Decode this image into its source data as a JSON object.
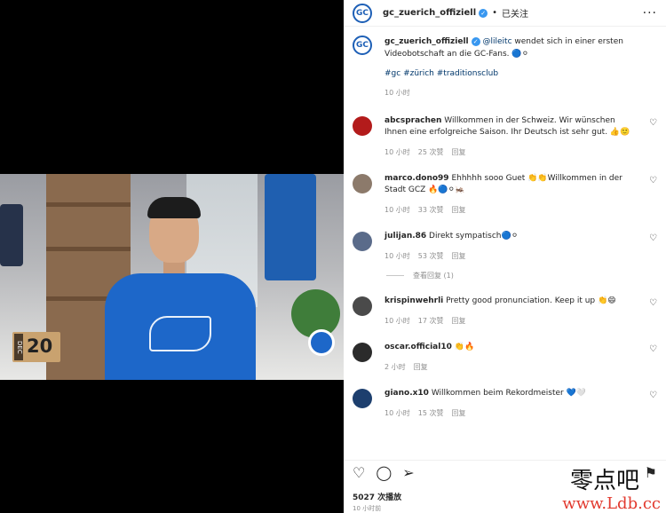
{
  "post": {
    "username": "gc_zuerich_offiziell",
    "follow_label": "已关注",
    "more_label": "···",
    "caption_mention": "@lileitc",
    "caption_text": " wendet sich in einer ersten Videobotschaft an die GC-Fans. 🔵⚪",
    "hashtags": "#gc #zürich #traditionsclub",
    "caption_time": "10 小时",
    "likes": "5027 次播放",
    "posted": "10 小时前"
  },
  "video": {
    "calendar_month": "DEC",
    "calendar_day": "20"
  },
  "comments": [
    {
      "user": "abcsprachen",
      "text": "Willkommen in der Schweiz. Wir wünschen Ihnen eine erfolgreiche Saison. Ihr Deutsch ist sehr gut. 👍🙂",
      "time": "10 小时",
      "likes": "25 次赞",
      "reply": "回复",
      "avatar_color": "#b31b1b"
    },
    {
      "user": "marco.dono99",
      "text": "Ehhhhh sooo Guet 👏👏Willkommen in der Stadt GCZ 🔥🔵⚪🦗",
      "time": "10 小时",
      "likes": "33 次赞",
      "reply": "回复",
      "avatar_color": "#8c7a6b"
    },
    {
      "user": "julijan.86",
      "text": "Direkt sympatisch🔵⚪",
      "time": "10 小时",
      "likes": "53 次赞",
      "reply": "回复",
      "avatar_color": "#5a6b8a",
      "view_replies": "查看回复 (1)"
    },
    {
      "user": "krispinwehrli",
      "text": "Pretty good pronunciation. Keep it up 👏😄",
      "time": "10 小时",
      "likes": "17 次赞",
      "reply": "回复",
      "avatar_color": "#4a4a4a"
    },
    {
      "user": "oscar.official10",
      "text": "👏🔥",
      "time": "2 小时",
      "likes": "",
      "reply": "回复",
      "avatar_color": "#2b2b2b"
    },
    {
      "user": "giano.x10",
      "text": "Willkommen beim Rekordmeister 💙🤍",
      "time": "10 小时",
      "likes": "15 次赞",
      "reply": "回复",
      "avatar_color": "#1d3f6e"
    }
  ],
  "watermark": {
    "line1": "零点吧",
    "line2": "www.Ldb.cc"
  }
}
